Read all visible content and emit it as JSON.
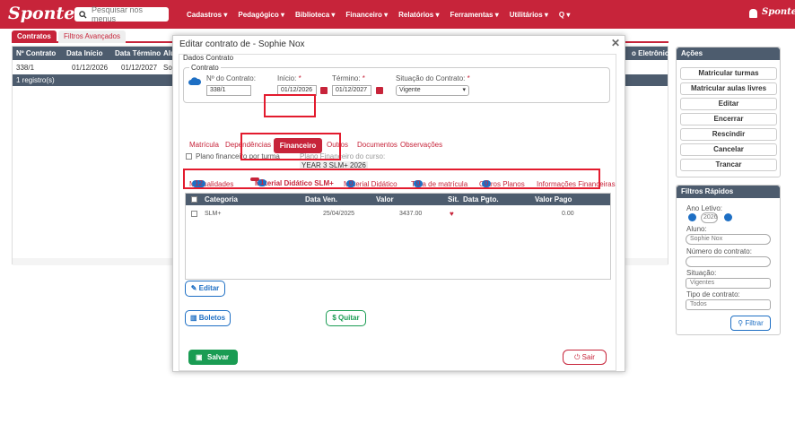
{
  "topbar": {
    "logo": "Sponte",
    "search_placeholder": "Pesquisar nos menus",
    "menu": [
      "Cadastros ▾",
      "Pedagógico ▾",
      "Biblioteca ▾",
      "Financeiro ▾",
      "Relatórios ▾",
      "Ferramentas ▾",
      "Utilitários ▾",
      "Q ▾"
    ],
    "logo_small": "Sponte"
  },
  "page_tabs": {
    "contratos": "Contratos",
    "filtros": "Filtros Avançados"
  },
  "bg_table": {
    "headers": [
      "Nº Contrato",
      "Data Início",
      "Data Término",
      "Alu",
      "o Eletrônico"
    ],
    "row": [
      "338/1",
      "01/12/2026",
      "01/12/2027",
      "Sop"
    ],
    "footer": "1 registro(s)"
  },
  "actions": {
    "title": "Ações",
    "buttons": [
      "Matricular turmas",
      "Matricular aulas livres",
      "Editar",
      "Encerrar",
      "Rescindir",
      "Cancelar",
      "Trancar"
    ]
  },
  "filters": {
    "title": "Filtros Rápidos",
    "ano_label": "Ano Letivo:",
    "ano_value": "2026",
    "aluno_label": "Aluno:",
    "aluno_value": "Sophie Nox",
    "numero_label": "Número do contrato:",
    "situacao_label": "Situação:",
    "situacao_value": "Vigentes",
    "tipo_label": "Tipo de contrato:",
    "tipo_value": "Todos",
    "filtrar": "Filtrar"
  },
  "modal": {
    "title": "Editar contrato de - Sophie Nox",
    "section": "Dados Contrato",
    "contract_group": "Contrato",
    "numero_label": "Nº do Contrato:",
    "numero_value": "338/1",
    "inicio_label": "Início:",
    "inicio_value": "01/12/2026",
    "termino_label": "Término:",
    "termino_value": "01/12/2027",
    "situacao_label": "Situação do Contrato:",
    "situacao_value": "Vigente",
    "tabs": [
      "Matrícula",
      "Dependências",
      "Financeiro",
      "Outros",
      "Documentos",
      "Observações"
    ],
    "plano_checkbox": "Plano financeiro por turma",
    "plano_curso_label": "Plano Financeiro do curso:",
    "plano_curso_value": "YEAR 3 SLM+ 2026",
    "inner_tabs": [
      {
        "label": "Mensalidades",
        "count": "12"
      },
      {
        "label": "Material Didático SLM+",
        "count": "1"
      },
      {
        "label": "Material Didático",
        "count": "0"
      },
      {
        "label": "Taxa de matrícula",
        "count": "0"
      },
      {
        "label": "Outros Planos",
        "count": "0"
      },
      {
        "label": "Informações Financeiras",
        "count": ""
      }
    ],
    "grid_headers": [
      "Categoria",
      "Data Ven.",
      "Valor",
      "Sit.",
      "Data Pgto.",
      "Valor Pago"
    ],
    "grid_row": {
      "categoria": "SLM+",
      "data_ven": "25/04/2025",
      "valor": "3437.00",
      "data_pgto": "",
      "valor_pago": "0.00"
    },
    "editar": "Editar",
    "boletos": "Boletos",
    "quitar": "Quitar",
    "salvar": "Salvar",
    "sair": "Sair"
  }
}
